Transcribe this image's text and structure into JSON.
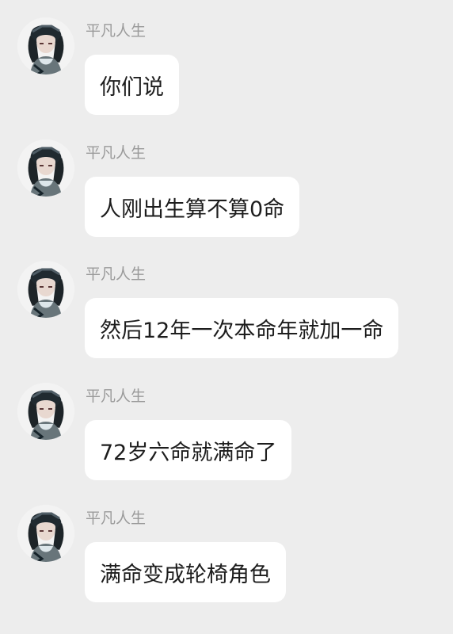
{
  "messages": [
    {
      "sender": "平凡人生",
      "text": "你们说"
    },
    {
      "sender": "平凡人生",
      "text": "人刚出生算不算0命"
    },
    {
      "sender": "平凡人生",
      "text": "然后12年一次本命年就加一命"
    },
    {
      "sender": "平凡人生",
      "text": "72岁六命就满命了"
    },
    {
      "sender": "平凡人生",
      "text": "满命变成轮椅角色"
    }
  ]
}
